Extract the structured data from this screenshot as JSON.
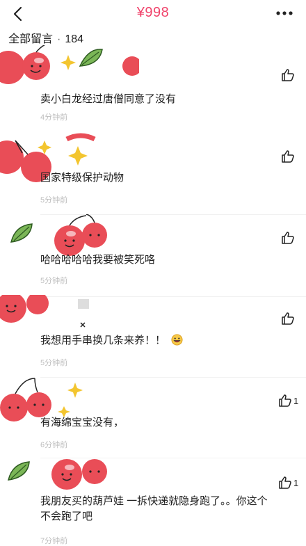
{
  "header": {
    "price": "¥998",
    "section_title": "全部留言",
    "separator": "·",
    "count": "184"
  },
  "comments": [
    {
      "text": "卖小白龙经过唐僧同意了没有",
      "time": "4分钟前",
      "likes": ""
    },
    {
      "text": "国家特级保护动物",
      "time": "5分钟前",
      "likes": ""
    },
    {
      "text": "哈哈哈哈哈我要被笑死咯",
      "time": "5分钟前",
      "likes": ""
    },
    {
      "text": "我想用手串换几条来养！！",
      "time": "5分钟前",
      "likes": "",
      "emoji": "grinning-emoji"
    },
    {
      "text": "有海绵宝宝没有，",
      "time": "6分钟前",
      "likes": "1"
    },
    {
      "text": "我朋友买的葫芦娃 一拆快递就隐身跑了。。你这个不会跑了吧",
      "time": "7分钟前",
      "likes": "1"
    }
  ],
  "colors": {
    "accent": "#f0436b",
    "cherry": "#e94d57",
    "leaf": "#4d8f3a"
  }
}
